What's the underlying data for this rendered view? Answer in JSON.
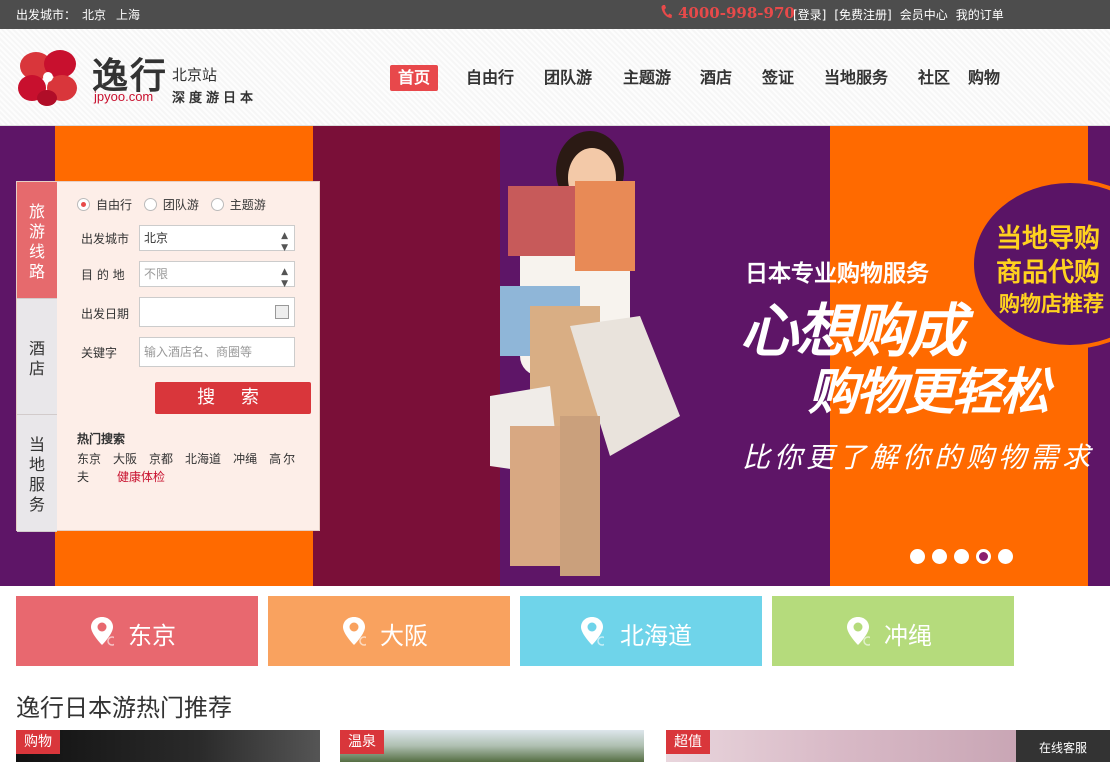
{
  "topbar": {
    "departure_label": "出发城市：",
    "cities": [
      "北京",
      "上海"
    ],
    "phone": "4000-998-970",
    "links": [
      "[登录]",
      "[免费注册]",
      "会员中心",
      "我的订单"
    ]
  },
  "header": {
    "logo_name": "逸行",
    "logo_domain": "jpyoo.com",
    "station": "北京站",
    "slogan": "深度游日本",
    "nav": [
      "首页",
      "自由行",
      "团队游",
      "主题游",
      "酒店",
      "签证",
      "当地服务",
      "社区",
      "购物"
    ]
  },
  "search": {
    "tabs": [
      "旅游线路",
      "酒店",
      "当地服务"
    ],
    "radios": [
      "自由行",
      "团队游",
      "主题游"
    ],
    "labels": {
      "from": "出发城市",
      "dest": "目 的 地",
      "date": "出发日期",
      "keyword": "关键字"
    },
    "from_value": "北京",
    "dest_value": "不限",
    "date_value": "",
    "keyword_placeholder": "输入酒店名、商圈等",
    "button": "搜 索",
    "hot_title": "热门搜索",
    "hot_links": [
      "东京",
      "大阪",
      "京都",
      "北海道",
      "冲绳",
      "高尔夫",
      "健康体检"
    ]
  },
  "banner": {
    "headline": "日本专业购物服务",
    "slogan_a": "心想购成",
    "slogan_b": "购物更轻松",
    "tagline": "比你更了解你的购物需求",
    "promo": [
      "当地导购",
      "商品代购",
      "购物店推荐"
    ],
    "active_slide": 4,
    "slide_count": 5
  },
  "cities": [
    {
      "name": "东京",
      "color": "#e8686f"
    },
    {
      "name": "大阪",
      "color": "#f9a25f"
    },
    {
      "name": "北海道",
      "color": "#6fd4ea"
    },
    {
      "name": "冲绳",
      "color": "#b5db7c"
    }
  ],
  "section_title": "逸行日本游热门推荐",
  "cards": [
    "购物",
    "温泉",
    "超值"
  ],
  "online_service": "在线客服",
  "colors": {
    "accent": "#e8484b",
    "topbar": "#4d4d4d",
    "banner_purple": "#5e1567",
    "banner_orange": "#ff6a00"
  }
}
